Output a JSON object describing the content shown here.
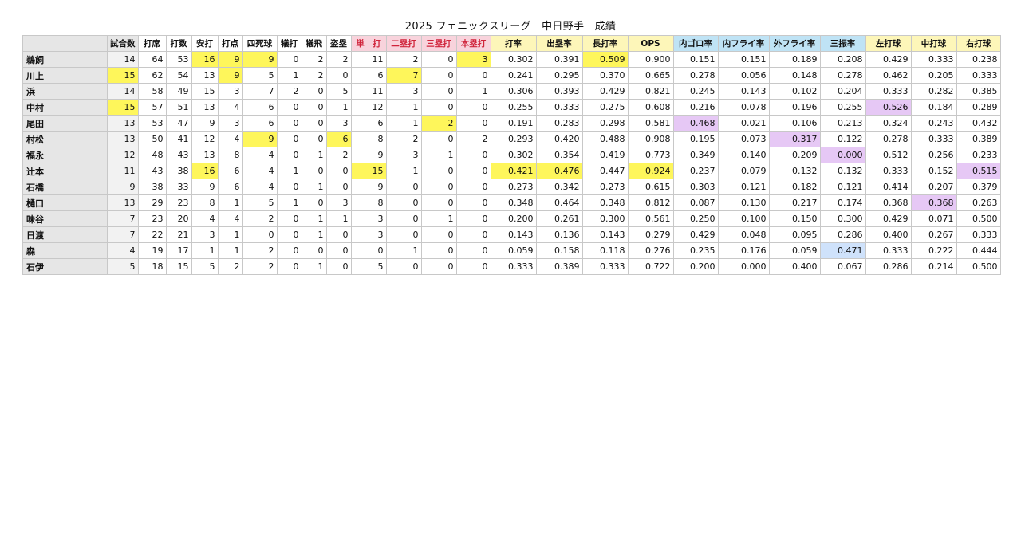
{
  "title": "2025 フェニックスリーグ　中日野手　成績",
  "columns": [
    {
      "label": "試合数",
      "bg": "#e6e6e6",
      "color": "#111111"
    },
    {
      "label": "打席",
      "bg": "#ffffff",
      "color": "#111111"
    },
    {
      "label": "打数",
      "bg": "#ffffff",
      "color": "#111111"
    },
    {
      "label": "安打",
      "bg": "#ffffff",
      "color": "#111111"
    },
    {
      "label": "打点",
      "bg": "#ffffff",
      "color": "#111111"
    },
    {
      "label": "四死球",
      "bg": "#ffffff",
      "color": "#111111"
    },
    {
      "label": "犠打",
      "bg": "#ffffff",
      "color": "#111111"
    },
    {
      "label": "犠飛",
      "bg": "#ffffff",
      "color": "#111111"
    },
    {
      "label": "盗塁",
      "bg": "#ffffff",
      "color": "#111111"
    },
    {
      "label": "単　打",
      "bg": "#f8d3dc",
      "color": "#d0243b"
    },
    {
      "label": "二塁打",
      "bg": "#f8d3dc",
      "color": "#d0243b"
    },
    {
      "label": "三塁打",
      "bg": "#f8d3dc",
      "color": "#d0243b"
    },
    {
      "label": "本塁打",
      "bg": "#f8d3dc",
      "color": "#d0243b"
    },
    {
      "label": "打率",
      "bg": "#fdf6b9",
      "color": "#111111"
    },
    {
      "label": "出塁率",
      "bg": "#fdf6b9",
      "color": "#111111"
    },
    {
      "label": "長打率",
      "bg": "#fdf6b9",
      "color": "#111111"
    },
    {
      "label": "OPS",
      "bg": "#fdf6b9",
      "color": "#111111"
    },
    {
      "label": "内ゴロ率",
      "bg": "#bfe3f5",
      "color": "#111111"
    },
    {
      "label": "内フライ率",
      "bg": "#bfe3f5",
      "color": "#111111"
    },
    {
      "label": "外フライ率",
      "bg": "#bfe3f5",
      "color": "#111111"
    },
    {
      "label": "三振率",
      "bg": "#bfe3f5",
      "color": "#111111"
    },
    {
      "label": "左打球",
      "bg": "#fdf6b9",
      "color": "#111111"
    },
    {
      "label": "中打球",
      "bg": "#fdf6b9",
      "color": "#111111"
    },
    {
      "label": "右打球",
      "bg": "#fdf6b9",
      "color": "#111111"
    }
  ],
  "players": [
    {
      "name": "鵜飼",
      "values": [
        "14",
        "64",
        "53",
        "16",
        "9",
        "9",
        "0",
        "2",
        "2",
        "11",
        "2",
        "0",
        "3",
        "0.302",
        "0.391",
        "0.509",
        "0.900",
        "0.151",
        "0.151",
        "0.189",
        "0.208",
        "0.429",
        "0.333",
        "0.238"
      ],
      "highlights": {
        "3": "y",
        "4": "y",
        "5": "y",
        "12": "y",
        "15": "y"
      }
    },
    {
      "name": "川上",
      "values": [
        "15",
        "62",
        "54",
        "13",
        "9",
        "5",
        "1",
        "2",
        "0",
        "6",
        "7",
        "0",
        "0",
        "0.241",
        "0.295",
        "0.370",
        "0.665",
        "0.278",
        "0.056",
        "0.148",
        "0.278",
        "0.462",
        "0.205",
        "0.333"
      ],
      "highlights": {
        "0": "y",
        "4": "y",
        "10": "y"
      }
    },
    {
      "name": "浜",
      "values": [
        "14",
        "58",
        "49",
        "15",
        "3",
        "7",
        "2",
        "0",
        "5",
        "11",
        "3",
        "0",
        "1",
        "0.306",
        "0.393",
        "0.429",
        "0.821",
        "0.245",
        "0.143",
        "0.102",
        "0.204",
        "0.333",
        "0.282",
        "0.385"
      ],
      "highlights": {}
    },
    {
      "name": "中村",
      "values": [
        "15",
        "57",
        "51",
        "13",
        "4",
        "6",
        "0",
        "0",
        "1",
        "12",
        "1",
        "0",
        "0",
        "0.255",
        "0.333",
        "0.275",
        "0.608",
        "0.216",
        "0.078",
        "0.196",
        "0.255",
        "0.526",
        "0.184",
        "0.289"
      ],
      "highlights": {
        "0": "y",
        "21": "p"
      }
    },
    {
      "name": "尾田",
      "values": [
        "13",
        "53",
        "47",
        "9",
        "3",
        "6",
        "0",
        "0",
        "3",
        "6",
        "1",
        "2",
        "0",
        "0.191",
        "0.283",
        "0.298",
        "0.581",
        "0.468",
        "0.021",
        "0.106",
        "0.213",
        "0.324",
        "0.243",
        "0.432"
      ],
      "highlights": {
        "11": "y",
        "17": "p"
      }
    },
    {
      "name": "村松",
      "values": [
        "13",
        "50",
        "41",
        "12",
        "4",
        "9",
        "0",
        "0",
        "6",
        "8",
        "2",
        "0",
        "2",
        "0.293",
        "0.420",
        "0.488",
        "0.908",
        "0.195",
        "0.073",
        "0.317",
        "0.122",
        "0.278",
        "0.333",
        "0.389"
      ],
      "highlights": {
        "5": "y",
        "8": "y",
        "19": "p"
      }
    },
    {
      "name": "福永",
      "values": [
        "12",
        "48",
        "43",
        "13",
        "8",
        "4",
        "0",
        "1",
        "2",
        "9",
        "3",
        "1",
        "0",
        "0.302",
        "0.354",
        "0.419",
        "0.773",
        "0.349",
        "0.140",
        "0.209",
        "0.000",
        "0.512",
        "0.256",
        "0.233"
      ],
      "highlights": {
        "20": "p"
      }
    },
    {
      "name": "辻本",
      "values": [
        "11",
        "43",
        "38",
        "16",
        "6",
        "4",
        "1",
        "0",
        "0",
        "15",
        "1",
        "0",
        "0",
        "0.421",
        "0.476",
        "0.447",
        "0.924",
        "0.237",
        "0.079",
        "0.132",
        "0.132",
        "0.333",
        "0.152",
        "0.515"
      ],
      "highlights": {
        "3": "y",
        "9": "y",
        "13": "y",
        "14": "y",
        "16": "y",
        "23": "p"
      }
    },
    {
      "name": "石橋",
      "values": [
        "9",
        "38",
        "33",
        "9",
        "6",
        "4",
        "0",
        "1",
        "0",
        "9",
        "0",
        "0",
        "0",
        "0.273",
        "0.342",
        "0.273",
        "0.615",
        "0.303",
        "0.121",
        "0.182",
        "0.121",
        "0.414",
        "0.207",
        "0.379"
      ],
      "highlights": {}
    },
    {
      "name": "樋口",
      "values": [
        "13",
        "29",
        "23",
        "8",
        "1",
        "5",
        "1",
        "0",
        "3",
        "8",
        "0",
        "0",
        "0",
        "0.348",
        "0.464",
        "0.348",
        "0.812",
        "0.087",
        "0.130",
        "0.217",
        "0.174",
        "0.368",
        "0.368",
        "0.263"
      ],
      "highlights": {
        "22": "p"
      }
    },
    {
      "name": "味谷",
      "values": [
        "7",
        "23",
        "20",
        "4",
        "4",
        "2",
        "0",
        "1",
        "1",
        "3",
        "0",
        "1",
        "0",
        "0.200",
        "0.261",
        "0.300",
        "0.561",
        "0.250",
        "0.100",
        "0.150",
        "0.300",
        "0.429",
        "0.071",
        "0.500"
      ],
      "highlights": {}
    },
    {
      "name": "日渡",
      "values": [
        "7",
        "22",
        "21",
        "3",
        "1",
        "0",
        "0",
        "1",
        "0",
        "3",
        "0",
        "0",
        "0",
        "0.143",
        "0.136",
        "0.143",
        "0.279",
        "0.429",
        "0.048",
        "0.095",
        "0.286",
        "0.400",
        "0.267",
        "0.333"
      ],
      "highlights": {}
    },
    {
      "name": "森",
      "values": [
        "4",
        "19",
        "17",
        "1",
        "1",
        "2",
        "0",
        "0",
        "0",
        "0",
        "1",
        "0",
        "0",
        "0.059",
        "0.158",
        "0.118",
        "0.276",
        "0.235",
        "0.176",
        "0.059",
        "0.471",
        "0.333",
        "0.222",
        "0.444"
      ],
      "highlights": {
        "20": "b"
      }
    },
    {
      "name": "石伊",
      "values": [
        "5",
        "18",
        "15",
        "5",
        "2",
        "2",
        "0",
        "1",
        "0",
        "5",
        "0",
        "0",
        "0",
        "0.333",
        "0.389",
        "0.333",
        "0.722",
        "0.200",
        "0.000",
        "0.400",
        "0.067",
        "0.286",
        "0.214",
        "0.500"
      ],
      "highlights": {}
    }
  ]
}
